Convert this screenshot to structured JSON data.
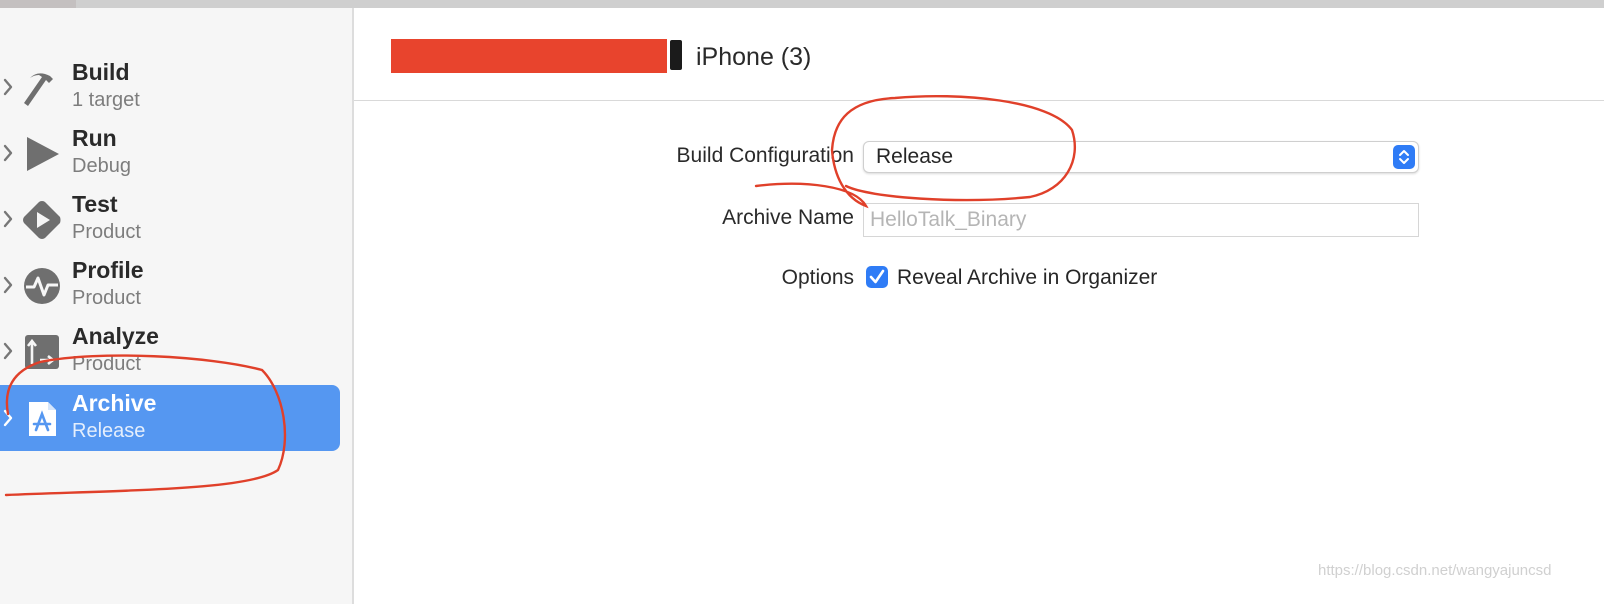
{
  "sidebar": {
    "items": [
      {
        "title": "Build",
        "subtitle": "1 target"
      },
      {
        "title": "Run",
        "subtitle": "Debug"
      },
      {
        "title": "Test",
        "subtitle": "Product"
      },
      {
        "title": "Profile",
        "subtitle": "Product"
      },
      {
        "title": "Analyze",
        "subtitle": "Product"
      },
      {
        "title": "Archive",
        "subtitle": "Release",
        "selected": true
      }
    ]
  },
  "header": {
    "device": "iPhone (3)"
  },
  "form": {
    "build_configuration_label": "Build Configuration",
    "build_configuration_value": "Release",
    "archive_name_label": "Archive Name",
    "archive_name_placeholder": "HelloTalk_Binary",
    "options_label": "Options",
    "reveal_archive_label": "Reveal Archive in Organizer",
    "reveal_archive_checked": true
  },
  "colors": {
    "selection": "#5597f1",
    "accent": "#2f7cf6",
    "annotation": "#e0402a"
  },
  "watermark": "https://blog.csdn.net/wangyajuncsd"
}
